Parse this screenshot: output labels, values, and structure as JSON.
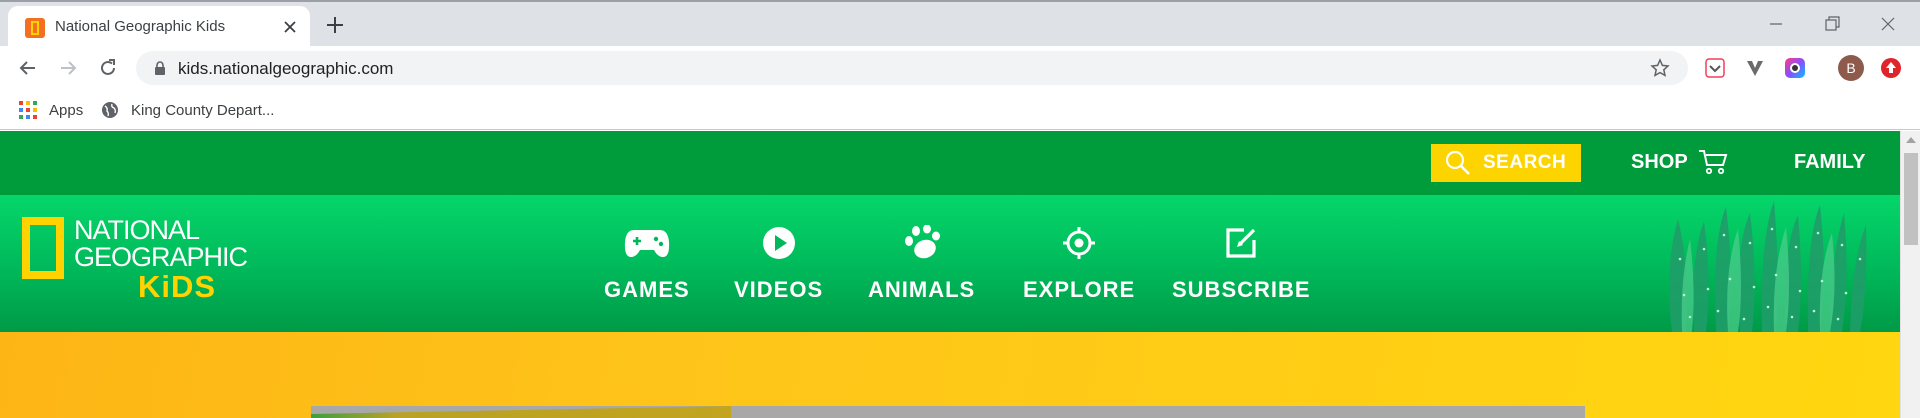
{
  "browser": {
    "tab": {
      "title": "National Geographic Kids"
    },
    "address": {
      "url": "kids.nationalgeographic.com"
    },
    "profile": {
      "initial": "B"
    },
    "bookmarks": [
      {
        "label": "Apps",
        "icon": "apps-grid-icon"
      },
      {
        "label": "King County Depart...",
        "icon": "globe-icon"
      }
    ]
  },
  "site": {
    "topbar": {
      "search_label": "SEARCH",
      "shop_label": "SHOP",
      "family_label": "FAMILY"
    },
    "logo": {
      "line1": "NATIONAL",
      "line2": "GEOGRAPHIC",
      "line3": "KiDS"
    },
    "nav": [
      {
        "label": "GAMES",
        "icon": "gamepad-icon"
      },
      {
        "label": "VIDEOS",
        "icon": "play-icon"
      },
      {
        "label": "ANIMALS",
        "icon": "paw-icon"
      },
      {
        "label": "EXPLORE",
        "icon": "crosshair-icon"
      },
      {
        "label": "SUBSCRIBE",
        "icon": "edit-icon"
      }
    ],
    "colors": {
      "topbar": "#009c3b",
      "nav_green": "#05d66a",
      "accent_yellow": "#fdd400",
      "hero_orange": "#fdb515"
    }
  }
}
